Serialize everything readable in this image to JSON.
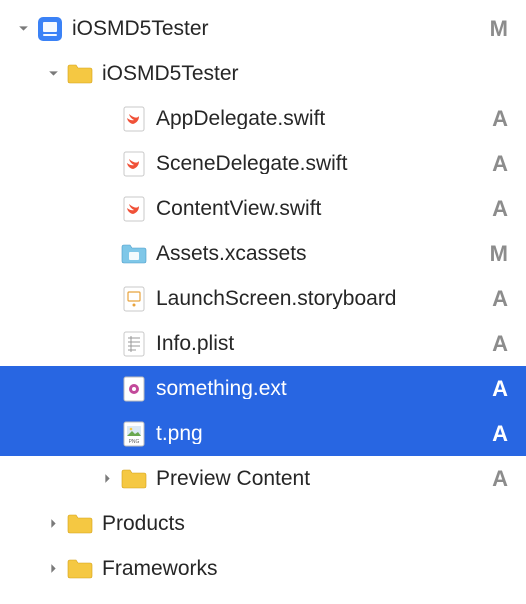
{
  "tree": {
    "root": {
      "label": "iOSMD5Tester",
      "status": "M",
      "expanded": true,
      "iconType": "project"
    },
    "group1": {
      "label": "iOSMD5Tester",
      "status": "",
      "expanded": true,
      "iconType": "folder"
    },
    "files": [
      {
        "label": "AppDelegate.swift",
        "status": "A",
        "iconType": "swift",
        "selected": false
      },
      {
        "label": "SceneDelegate.swift",
        "status": "A",
        "iconType": "swift",
        "selected": false
      },
      {
        "label": "ContentView.swift",
        "status": "A",
        "iconType": "swift",
        "selected": false
      },
      {
        "label": "Assets.xcassets",
        "status": "M",
        "iconType": "assets",
        "selected": false
      },
      {
        "label": "LaunchScreen.storyboard",
        "status": "A",
        "iconType": "storyboard",
        "selected": false
      },
      {
        "label": "Info.plist",
        "status": "A",
        "iconType": "plist",
        "selected": false
      },
      {
        "label": "something.ext",
        "status": "A",
        "iconType": "generic",
        "selected": true
      },
      {
        "label": "t.png",
        "status": "A",
        "iconType": "png",
        "selected": true
      }
    ],
    "preview": {
      "label": "Preview Content",
      "status": "A",
      "expanded": false,
      "iconType": "folder"
    },
    "products": {
      "label": "Products",
      "status": "",
      "expanded": false,
      "iconType": "folder"
    },
    "frameworks": {
      "label": "Frameworks",
      "status": "",
      "expanded": false,
      "iconType": "folder"
    }
  },
  "icons": {
    "project": "project-icon",
    "folder": "folder-icon",
    "swift": "swift-file-icon",
    "assets": "assets-folder-icon",
    "storyboard": "storyboard-file-icon",
    "plist": "plist-file-icon",
    "generic": "generic-file-icon",
    "png": "png-file-icon"
  }
}
